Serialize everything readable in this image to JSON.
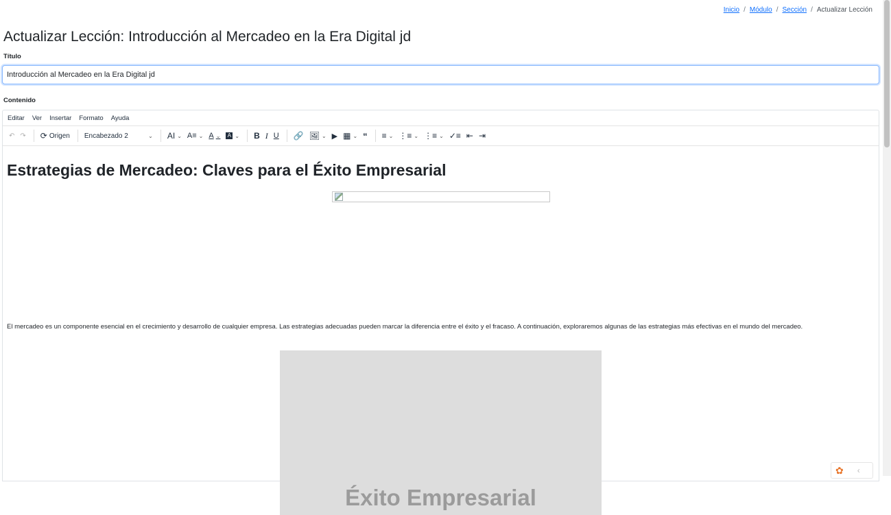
{
  "breadcrumb": {
    "items": [
      "Inicio",
      "Módulo",
      "Sección"
    ],
    "separator": "/",
    "current": "Actualizar Lección"
  },
  "page_title": "Actualizar Lección: Introducción al Mercadeo en la Era Digital jd",
  "form": {
    "title_label": "Título",
    "title_value": "Introducción al Mercadeo en la Era Digital jd",
    "content_label": "Contenido"
  },
  "editor": {
    "menu": [
      "Editar",
      "Ver",
      "Insertar",
      "Formato",
      "Ayuda"
    ],
    "toolbar": {
      "source_label": "Origen",
      "block_format": "Encabezado 2"
    },
    "content": {
      "heading": "Estrategias de Mercadeo: Claves para el Éxito Empresarial",
      "paragraph": "El mercadeo es un componente esencial en el crecimiento y desarrollo de cualquier empresa. Las estrategias adecuadas pueden marcar la diferencia entre el éxito y el fracaso. A continuación, exploraremos algunas de las estrategias más efectivas en el mundo del mercadeo.",
      "image_text": "Éxito Empresarial"
    }
  },
  "colors": {
    "link": "#0d6efd",
    "input_focus_border": "#86b7fe",
    "placeholder_bg": "#dddddd"
  }
}
